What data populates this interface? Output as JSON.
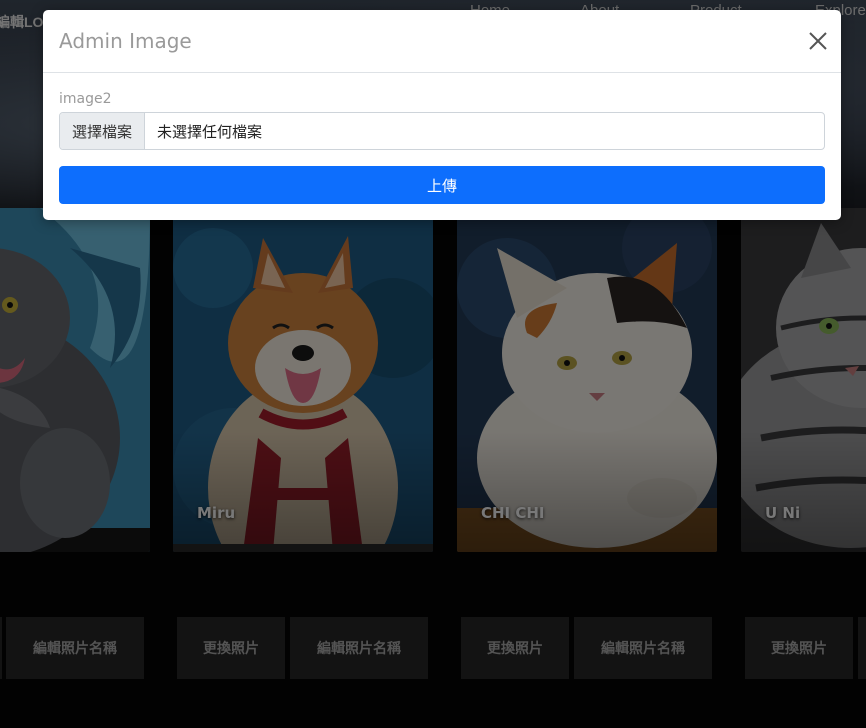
{
  "nav": {
    "logo": "編輯LO",
    "links": [
      "Home",
      "About",
      "Product",
      "Explore"
    ]
  },
  "cards": [
    {
      "name": ""
    },
    {
      "name": "Miru"
    },
    {
      "name": "CHI CHI"
    },
    {
      "name": "U Ni"
    }
  ],
  "actions": {
    "change_photo": "更換照片",
    "edit_name": "編輯照片名稱"
  },
  "modal": {
    "title": "Admin Image",
    "field_label": "image2",
    "file_button": "選擇檔案",
    "file_status": "未選擇任何檔案",
    "upload_label": "上傳"
  },
  "colors": {
    "primary": "#0d6efd",
    "dark_button": "#262626"
  }
}
